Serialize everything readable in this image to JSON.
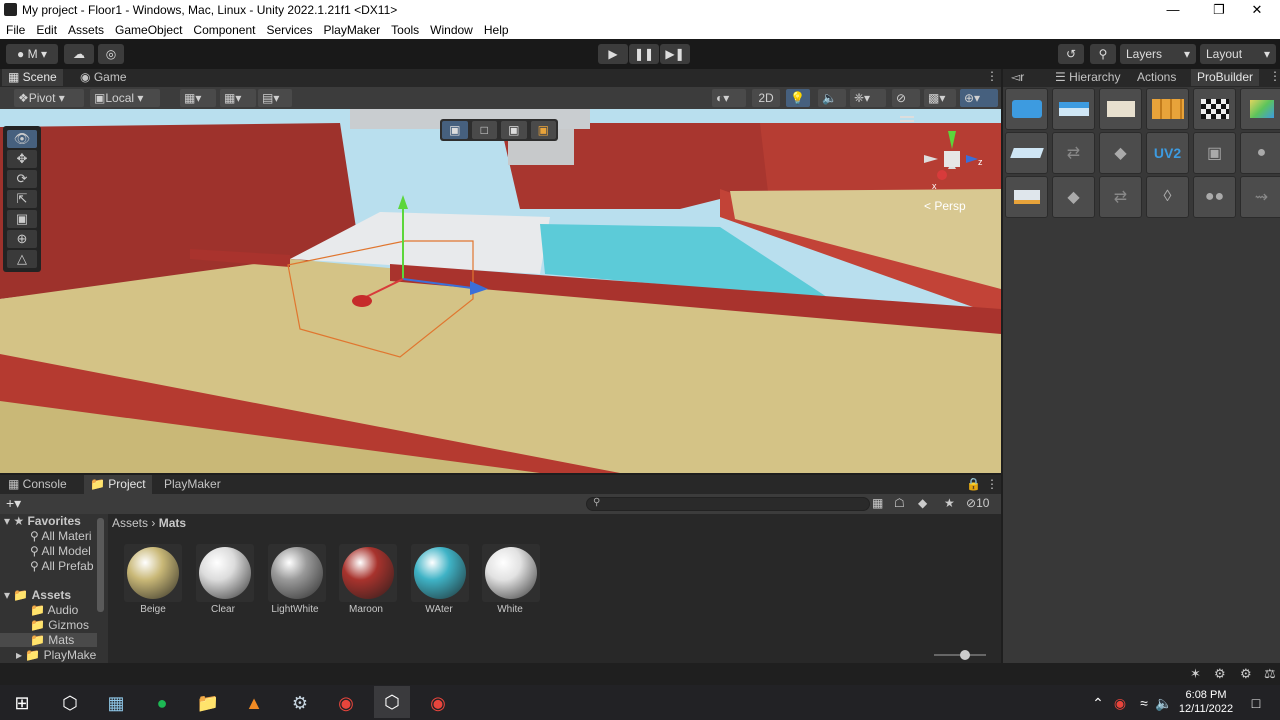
{
  "window": {
    "title": "My project - Floor1 - Windows, Mac, Linux - Unity 2022.1.21f1 <DX11>"
  },
  "menu": [
    "File",
    "Edit",
    "Assets",
    "GameObject",
    "Component",
    "Services",
    "PlayMaker",
    "Tools",
    "Window",
    "Help"
  ],
  "toolbar": {
    "account_label": "M",
    "layers_label": "Layers",
    "layout_label": "Layout"
  },
  "scene_tabs": {
    "scene": "Scene",
    "game": "Game"
  },
  "scene_toolbar": {
    "pivot": "Pivot",
    "local": "Local",
    "mode_2d": "2D"
  },
  "gizmo": {
    "persp": "Persp",
    "axis_z": "z",
    "axis_x": "x"
  },
  "right_tabs": {
    "truncated": "r",
    "hierarchy": "Hierarchy",
    "actions": "Actions",
    "probuilder": "ProBuilder"
  },
  "probuilder_icons": {
    "uv2": "UV2"
  },
  "bottom_tabs": {
    "console": "Console",
    "project": "Project",
    "playmaker": "PlayMaker"
  },
  "project": {
    "hidden_count": "10",
    "breadcrumb": {
      "root": "Assets",
      "sep": "›",
      "current": "Mats"
    },
    "favorites": {
      "label": "Favorites",
      "items": [
        "All Materi",
        "All Model",
        "All Prefab"
      ]
    },
    "assets": {
      "label": "Assets",
      "items": [
        "Audio",
        "Gizmos",
        "Mats",
        "PlayMake"
      ]
    },
    "materials": [
      {
        "name": "Beige",
        "color": "#c9b877"
      },
      {
        "name": "Clear",
        "color": "#dcdcdc"
      },
      {
        "name": "LightWhite",
        "color": "#9a9a9a"
      },
      {
        "name": "Maroon",
        "color": "#a8332d"
      },
      {
        "name": "WAter",
        "color": "#3fb3c6"
      },
      {
        "name": "White",
        "color": "#e2e2e2"
      }
    ]
  },
  "taskbar": {
    "time": "6:08 PM",
    "date": "12/11/2022"
  },
  "colors": {
    "accent": "#3a79bb",
    "wall": "#a8332d",
    "floor": "#d5c486",
    "water": "#5ccbd8"
  }
}
